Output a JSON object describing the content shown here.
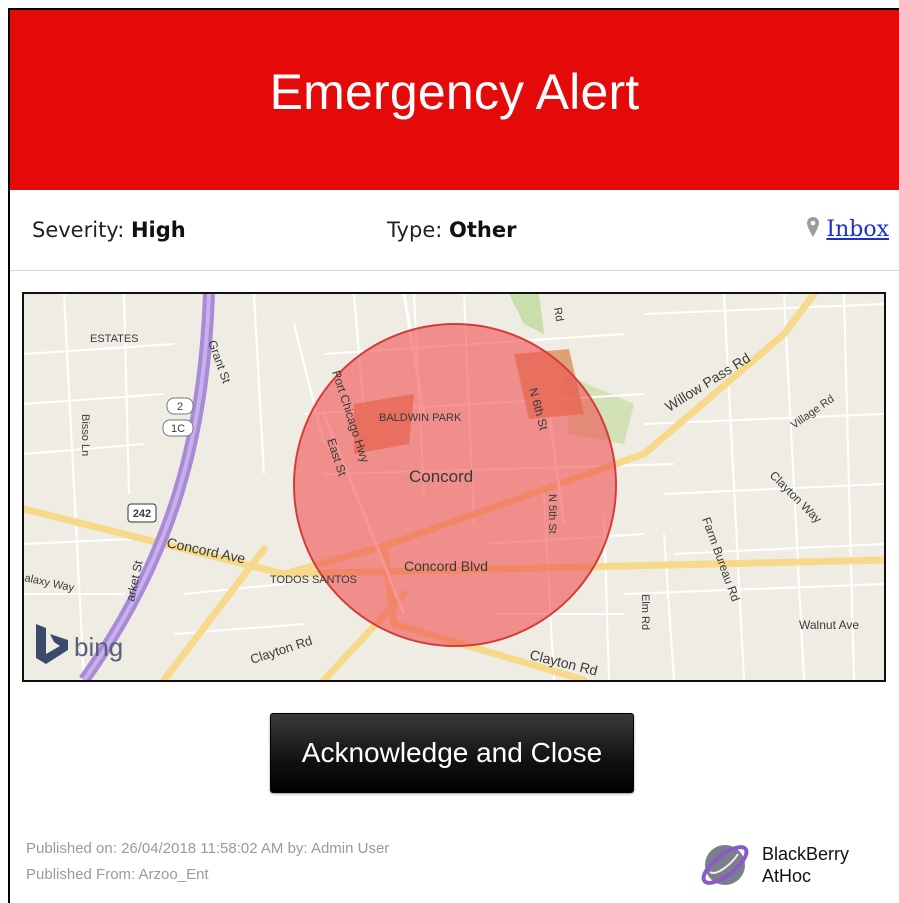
{
  "alert": {
    "title": "Emergency Alert",
    "header_color": "#e50a0a"
  },
  "info": {
    "severity_label": "Severity:",
    "severity_value": "High",
    "type_label": "Type:",
    "type_value": "Other",
    "inbox_link": "Inbox",
    "inbox_icon": "map-pin-icon"
  },
  "map": {
    "provider": "bing",
    "center_label": "Concord",
    "labels": {
      "estates": "ESTATES",
      "baldwin_park": "BALDWIN PARK",
      "todos_santos": "TODOS SANTOS",
      "concord_blvd": "Concord Blvd",
      "concord_ave": "Concord Ave",
      "willow_pass": "Willow Pass Rd",
      "clayton_rd_left": "Clayton Rd",
      "clayton_rd_right": "Clayton Rd",
      "village_rd": "Village Rd",
      "clayton_way": "Clayton Way",
      "farm_bureau": "Farm Bureau Rd",
      "walnut_ave": "Walnut Ave",
      "elm_rd": "Elm Rd",
      "n6th": "N 6th St",
      "n5th": "N 5th St",
      "east_st": "East St",
      "port_chicago": "Port Chicago Hwy",
      "grant_st": "Grant St",
      "bisso_ln": "Bisso Ln",
      "market_st": "arket St",
      "galaxy_way": "alaxy Way",
      "rd_top": "Rd",
      "route_2": "2",
      "route_1c": "1C",
      "route_242": "242"
    },
    "alert_circle_color": "#f05050"
  },
  "actions": {
    "acknowledge_label": "Acknowledge and Close"
  },
  "footer": {
    "published_on": "Published on: 26/04/2018 11:58:02 AM  by: Admin User",
    "published_from": "Published From: Arzoo_Ent"
  },
  "brand": {
    "line1": "BlackBerry",
    "line2": "AtHoc"
  }
}
